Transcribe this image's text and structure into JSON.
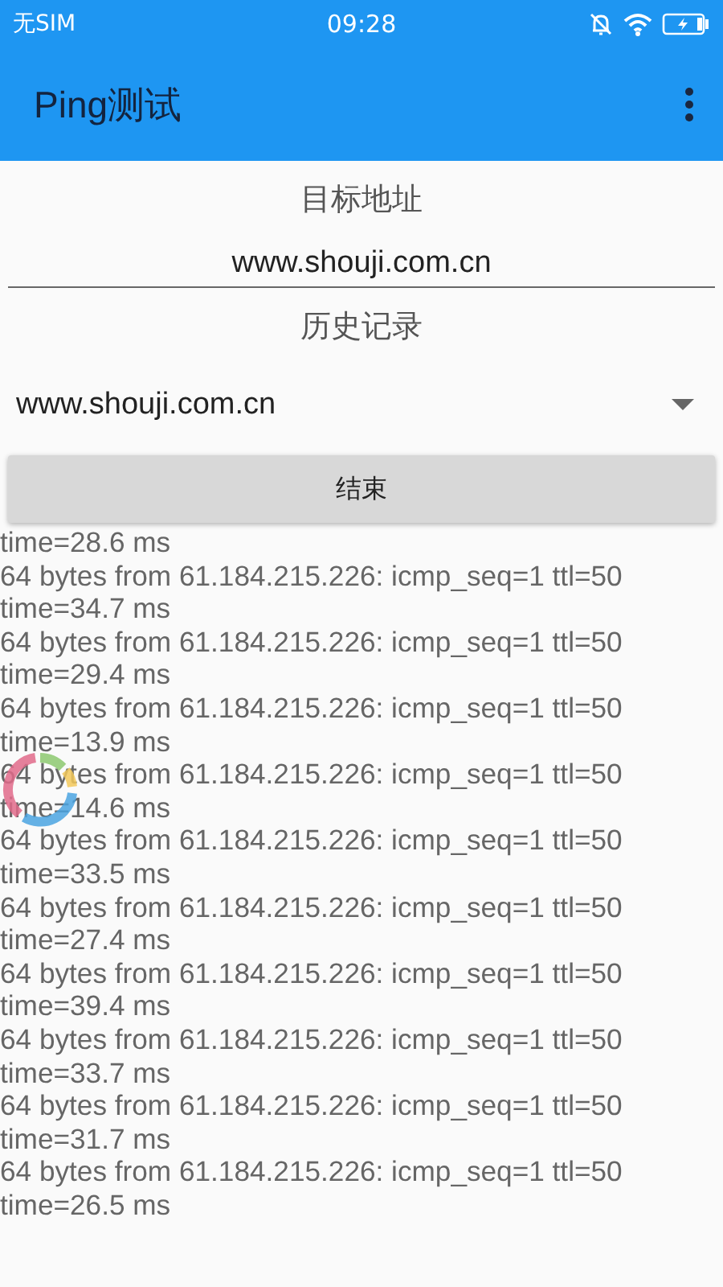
{
  "status_bar": {
    "carrier": "无SIM",
    "time": "09:28"
  },
  "app_bar": {
    "title": "Ping测试"
  },
  "target": {
    "label": "目标地址",
    "value": "www.shouji.com.cn"
  },
  "history": {
    "label": "历史记录",
    "selected_value": "www.shouji.com.cn"
  },
  "stop_button": {
    "label": "结束"
  },
  "log_lines": [
    "time=28.6 ms",
    "64 bytes from 61.184.215.226: icmp_seq=1 ttl=50",
    "time=34.7 ms",
    "64 bytes from 61.184.215.226: icmp_seq=1 ttl=50",
    "time=29.4 ms",
    "64 bytes from 61.184.215.226: icmp_seq=1 ttl=50",
    "time=13.9 ms",
    "64 bytes from 61.184.215.226: icmp_seq=1 ttl=50",
    "time=14.6 ms",
    "64 bytes from 61.184.215.226: icmp_seq=1 ttl=50",
    "time=33.5 ms",
    "64 bytes from 61.184.215.226: icmp_seq=1 ttl=50",
    "time=27.4 ms",
    "64 bytes from 61.184.215.226: icmp_seq=1 ttl=50",
    "time=39.4 ms",
    "64 bytes from 61.184.215.226: icmp_seq=1 ttl=50",
    "time=33.7 ms",
    "64 bytes from 61.184.215.226: icmp_seq=1 ttl=50",
    "time=31.7 ms",
    "64 bytes from 61.184.215.226: icmp_seq=1 ttl=50",
    "time=26.5 ms"
  ]
}
